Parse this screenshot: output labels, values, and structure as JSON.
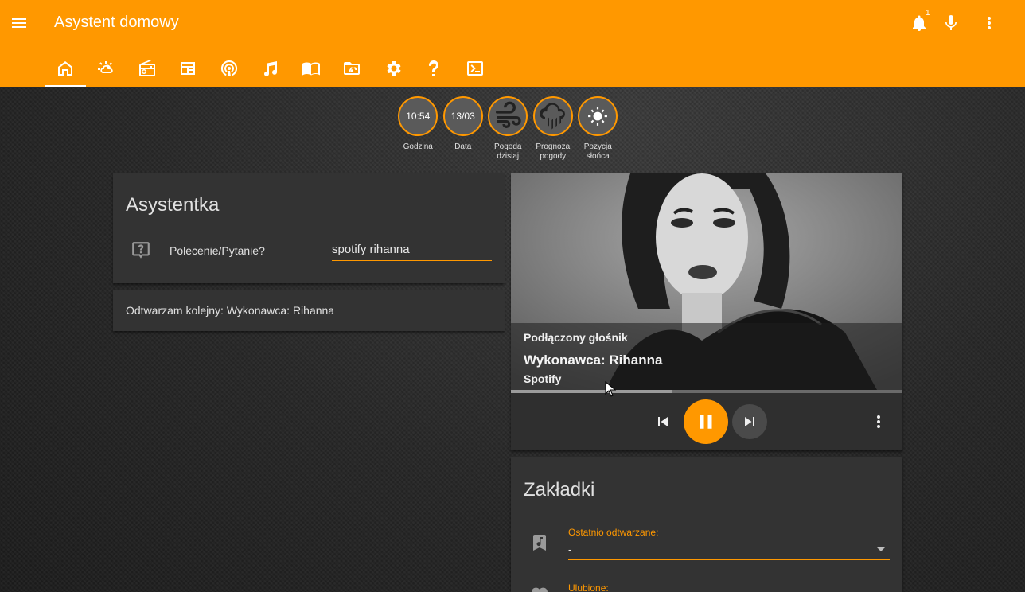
{
  "app": {
    "title": "Asystent domowy",
    "notification_count": "1"
  },
  "header": {
    "icons": [
      "menu-icon",
      "bell-icon",
      "microphone-icon",
      "more-vert-icon"
    ],
    "tabs": [
      {
        "name": "home",
        "icon": "home-icon",
        "active": true
      },
      {
        "name": "weather",
        "icon": "weather-partly-cloudy-icon"
      },
      {
        "name": "radio",
        "icon": "radio-icon"
      },
      {
        "name": "calendar",
        "icon": "calendar-view-icon"
      },
      {
        "name": "podcast",
        "icon": "podcast-icon"
      },
      {
        "name": "music",
        "icon": "music-note-icon"
      },
      {
        "name": "books",
        "icon": "book-open-icon"
      },
      {
        "name": "drive",
        "icon": "folder-drive-icon"
      },
      {
        "name": "settings",
        "icon": "gear-icon"
      },
      {
        "name": "help",
        "icon": "question-mark-icon"
      },
      {
        "name": "console",
        "icon": "console-icon"
      }
    ]
  },
  "badges": [
    {
      "value": "10:54",
      "label": "Godzina"
    },
    {
      "value": "13/03",
      "label": "Data"
    },
    {
      "icon": "wind-icon",
      "label": "Pogoda dzisiaj"
    },
    {
      "icon": "rain-cloud-icon",
      "label": "Prognoza pogody"
    },
    {
      "icon": "sun-icon",
      "label": "Pozycja słońca"
    }
  ],
  "assistant": {
    "title": "Asystentka",
    "field_label": "Polecenie/Pytanie?",
    "field_value": "spotify rihanna",
    "reply": "Odtwarzam kolejny: Wykonawca: Rihanna"
  },
  "media": {
    "device": "Podłączony głośnik",
    "title": "Wykonawca: Rihanna",
    "app": "Spotify",
    "progress": 0.41,
    "state": "playing"
  },
  "bookmarks": {
    "title": "Zakładki",
    "recent_label": "Ostatnio odtwarzane:",
    "recent_value": "-",
    "favorites_label": "Ulubione:"
  },
  "colors": {
    "accent": "#ff9800",
    "card": "#333333",
    "background": "#262626"
  }
}
